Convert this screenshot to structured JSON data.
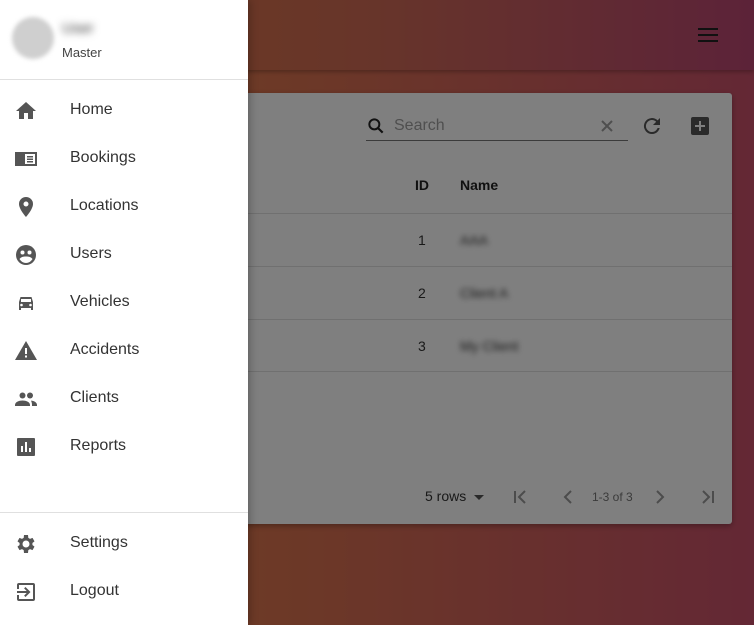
{
  "drawer": {
    "user": {
      "name": "User",
      "role": "Master"
    },
    "items": [
      {
        "label": "Home",
        "icon": "home-icon"
      },
      {
        "label": "Bookings",
        "icon": "bookings-icon"
      },
      {
        "label": "Locations",
        "icon": "location-pin-icon"
      },
      {
        "label": "Users",
        "icon": "users-icon"
      },
      {
        "label": "Vehicles",
        "icon": "car-icon"
      },
      {
        "label": "Accidents",
        "icon": "warning-icon"
      },
      {
        "label": "Clients",
        "icon": "people-icon"
      },
      {
        "label": "Reports",
        "icon": "reports-icon"
      }
    ],
    "footer_items": [
      {
        "label": "Settings",
        "icon": "gear-icon"
      },
      {
        "label": "Logout",
        "icon": "logout-icon"
      }
    ]
  },
  "table": {
    "search": {
      "placeholder": "Search",
      "value": ""
    },
    "columns": [
      "ID",
      "Name"
    ],
    "rows": [
      {
        "id": "1",
        "name": "AAA"
      },
      {
        "id": "2",
        "name": "Client A"
      },
      {
        "id": "3",
        "name": "My Client"
      }
    ],
    "pagination": {
      "rows_per_page": "5 rows",
      "range": "1-3 of 3"
    }
  },
  "colors": {
    "appbar_start": "#e07a3f",
    "appbar_end": "#b94672",
    "icon": "#555555"
  }
}
